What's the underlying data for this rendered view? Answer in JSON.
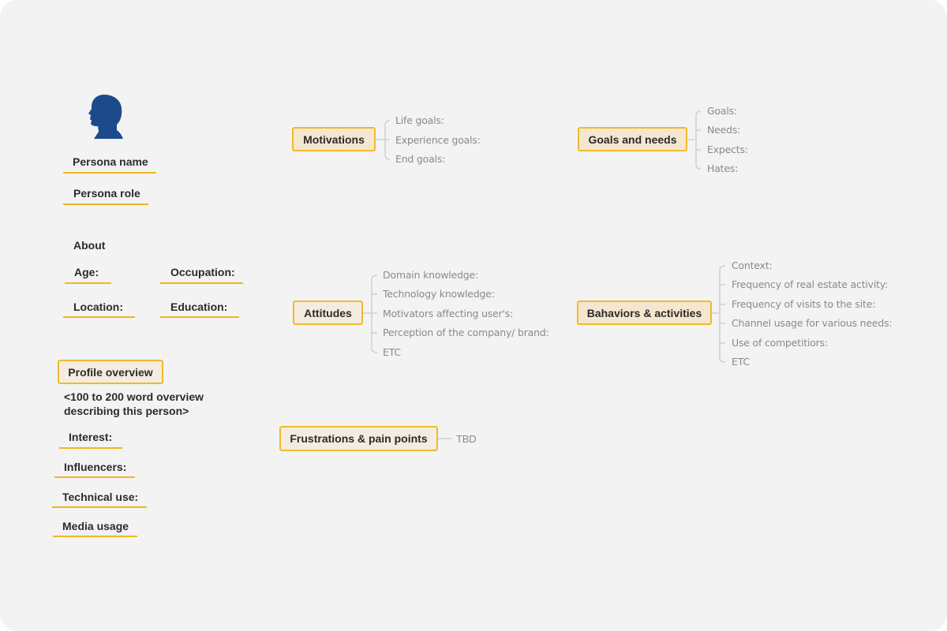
{
  "persona": {
    "avatar_icon": "person-head-silhouette-icon",
    "avatar_color": "#1c4b8b",
    "name_label": "Persona name",
    "role_label": "Persona role"
  },
  "about": {
    "heading": "About",
    "age_label": "Age:",
    "occupation_label": "Occupation:",
    "location_label": "Location:",
    "education_label": "Education:"
  },
  "profile": {
    "heading": "Profile overview",
    "overview_line1": "<100 to 200 word overview",
    "overview_line2": "describing this person>",
    "interest_label": "Interest:",
    "influencers_label": "Influencers:",
    "technical_use_label": "Technical use:",
    "media_usage_label": "Media usage"
  },
  "topics": {
    "motivations": {
      "label": "Motivations",
      "items": [
        "Life goals:",
        "Experience goals:",
        "End goals:"
      ]
    },
    "goals_needs": {
      "label": "Goals and needs",
      "items": [
        "Goals:",
        "Needs:",
        "Expects:",
        "Hates:"
      ]
    },
    "attitudes": {
      "label": "Attitudes",
      "items": [
        "Domain knowledge:",
        "Technology knowledge:",
        "Motivators affecting user's:",
        "Perception of the company/ brand:",
        "ETC"
      ]
    },
    "behaviors": {
      "label": "Bahaviors & activities",
      "items": [
        "Context:",
        "Frequency of real estate activity:",
        "Frequency of visits to the site:",
        "Channel usage for various needs:",
        "Use of competitiors:",
        "ETC"
      ]
    },
    "frustrations": {
      "label": "Frustrations & pain points",
      "items": [
        "TBD"
      ]
    }
  },
  "colors": {
    "accent": "#f0b81c",
    "node_fill": "#f5e6cf",
    "background": "#f3f3f3",
    "leaf_text": "#8a8a8a",
    "connector": "#d0d0d0"
  }
}
